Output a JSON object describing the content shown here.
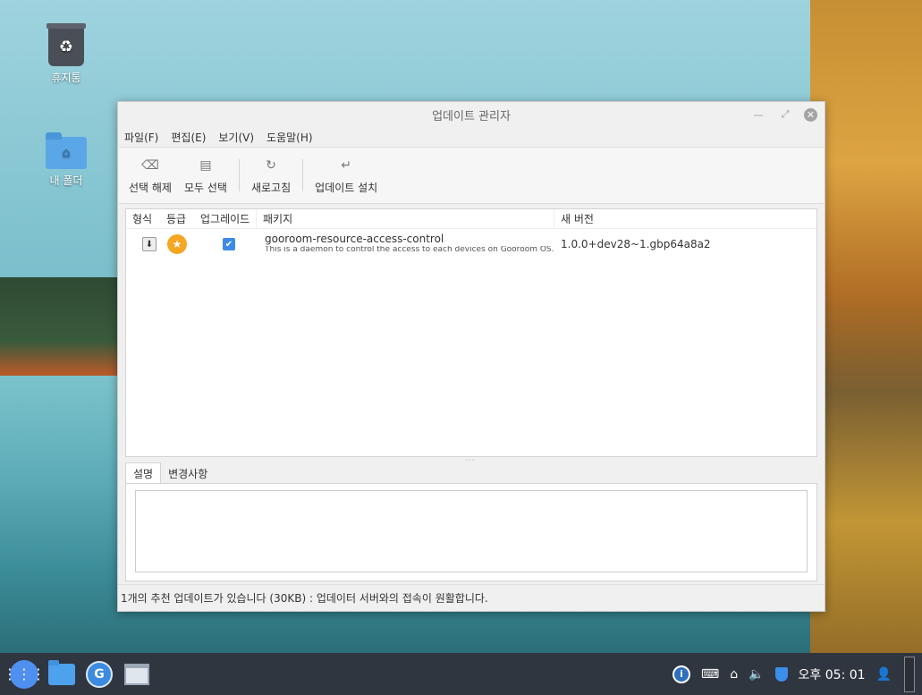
{
  "desktop": {
    "icons": [
      {
        "label": "휴지통",
        "icon": "trash-icon"
      },
      {
        "label": "내 폴더",
        "icon": "home-folder-icon"
      }
    ]
  },
  "window": {
    "title": "업데이트 관리자",
    "menus": [
      "파일(F)",
      "편집(E)",
      "보기(V)",
      "도움말(H)"
    ],
    "toolbar": [
      {
        "label": "선택 해제",
        "icon": "clear-icon"
      },
      {
        "label": "모두 선택",
        "icon": "list-icon"
      },
      {
        "label": "새로고침",
        "icon": "refresh-icon"
      },
      {
        "label": "업데이트 설치",
        "icon": "install-icon"
      }
    ],
    "columns": {
      "type": "형식",
      "level": "등급",
      "upgrade": "업그레이드",
      "package": "패키지",
      "new_version": "새 버전"
    },
    "packages": [
      {
        "type_icon": "download-icon",
        "level_icon": "star-icon",
        "upgrade_checked": true,
        "name": "gooroom-resource-access-control",
        "description": "This is a daemon to control the access to each devices on Gooroom OS.",
        "new_version": "1.0.0+dev28~1.gbp64a8a2"
      }
    ],
    "tabs": [
      "설명",
      "변경사항"
    ],
    "active_tab": "설명",
    "status": "1개의 추천 업데이트가 있습니다 (30KB) : 업데이터 서버와의 접속이 원활합니다."
  },
  "taskbar": {
    "apps": [
      "app-menu-icon",
      "file-manager-icon",
      "browser-icon",
      "window-icon"
    ],
    "tray_icons": [
      "info-icon",
      "keyboard-icon",
      "network-icon",
      "volume-icon",
      "shield-icon",
      "user-icon"
    ],
    "clock": "오후 05: 01"
  },
  "colors": {
    "accent": "#3d8be6",
    "star": "#f5a623",
    "taskbar": "#2f3640"
  }
}
